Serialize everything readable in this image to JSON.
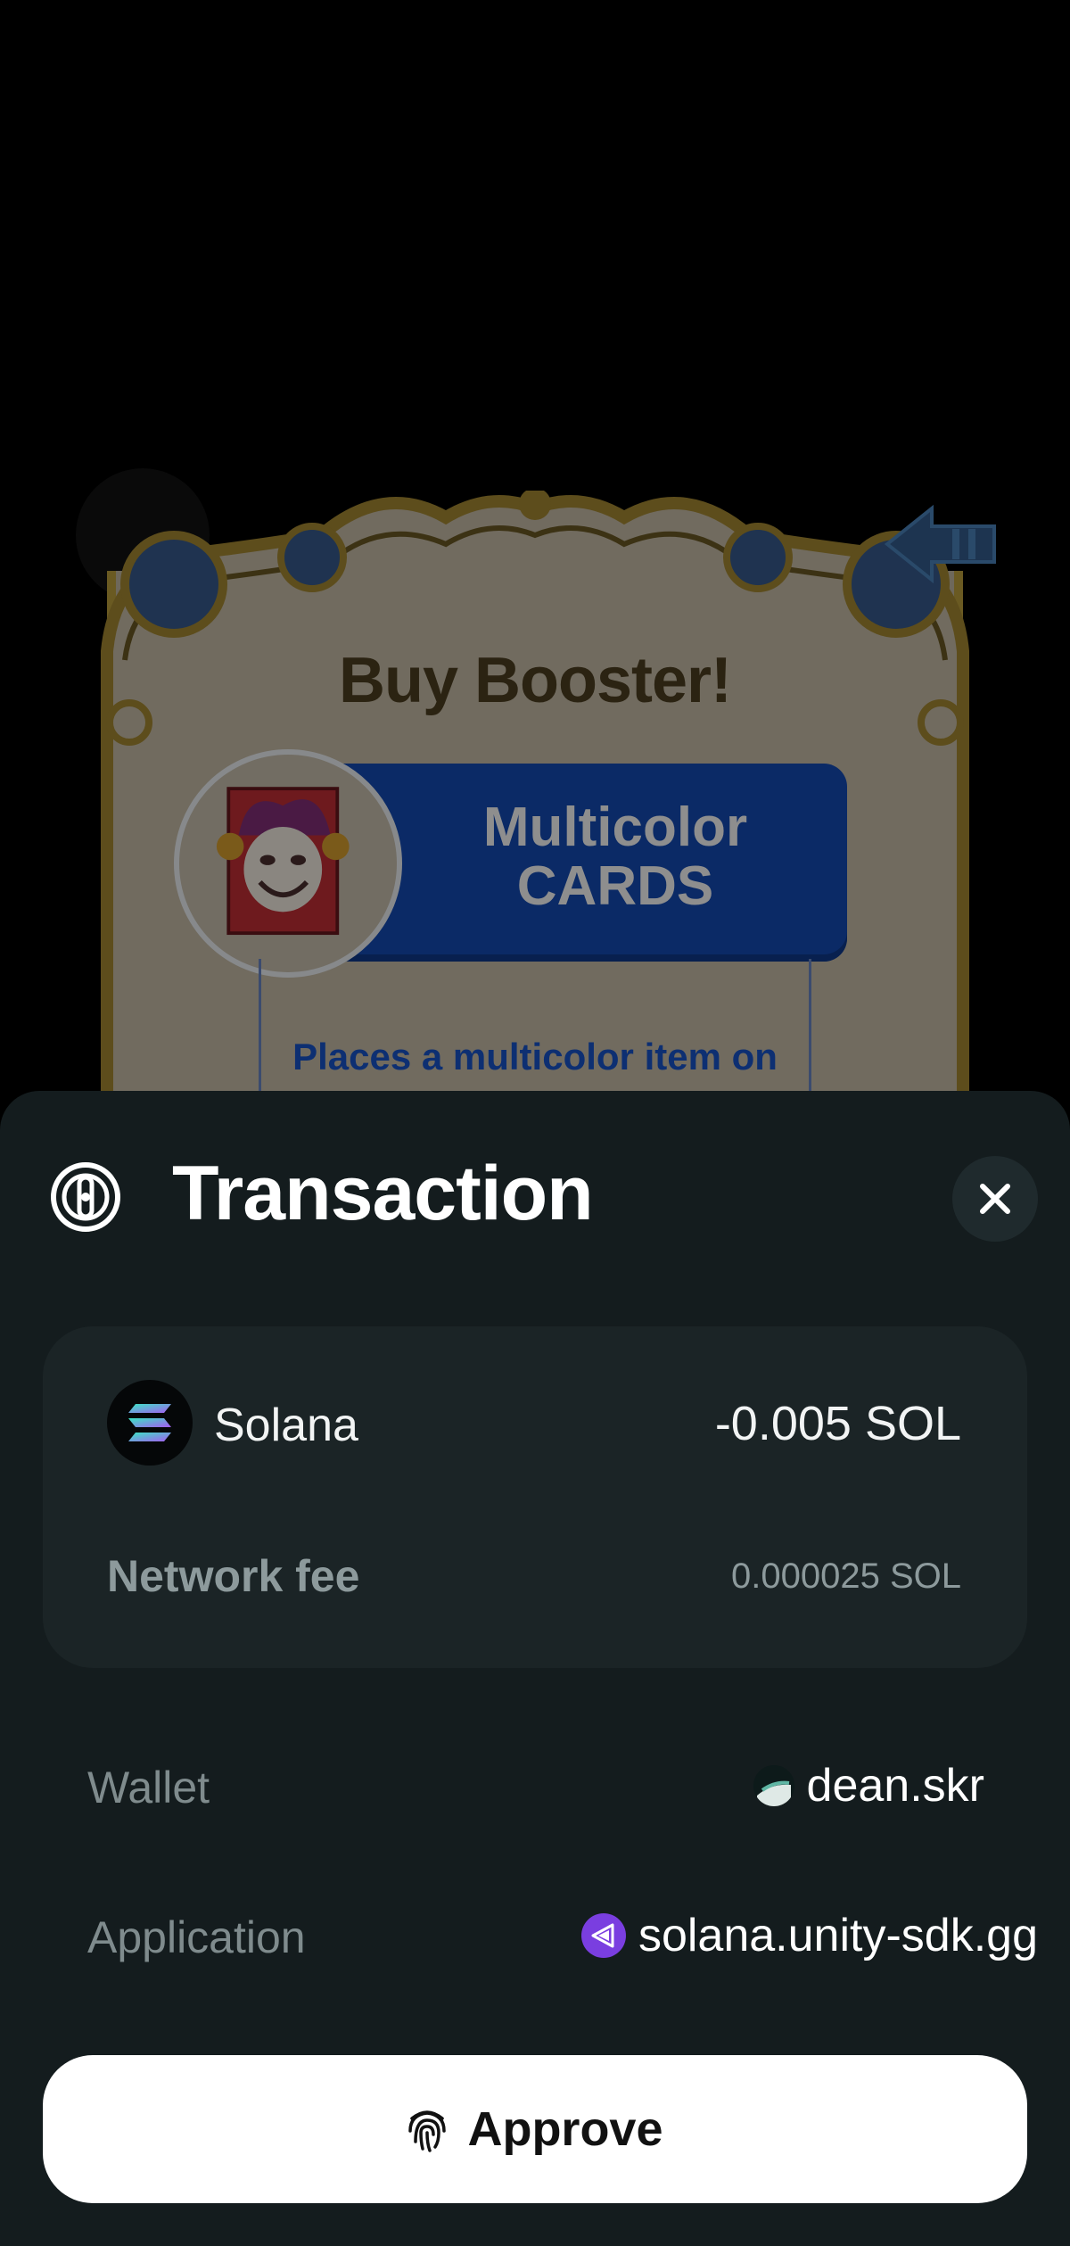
{
  "game": {
    "dialog_title": "Buy Booster!",
    "booster_line1": "Multicolor",
    "booster_line2": "CARDS",
    "description": "Places a multicolor item on"
  },
  "sheet": {
    "title": "Transaction",
    "logo_icon": "wallet-logo-icon",
    "close_icon": "close-icon"
  },
  "transaction": {
    "token_name": "Solana",
    "amount": "-0.005 SOL",
    "fee_label": "Network fee",
    "fee_value": "0.000025 SOL"
  },
  "details": {
    "wallet_label": "Wallet",
    "wallet_value": "dean.skr",
    "application_label": "Application",
    "application_value": "solana.unity-sdk.gg"
  },
  "actions": {
    "approve_label": "Approve",
    "approve_icon": "fingerprint-icon"
  },
  "colors": {
    "sheet_background": "#141c1e",
    "card_background": "#1b2426",
    "button_background": "#ffffff"
  }
}
